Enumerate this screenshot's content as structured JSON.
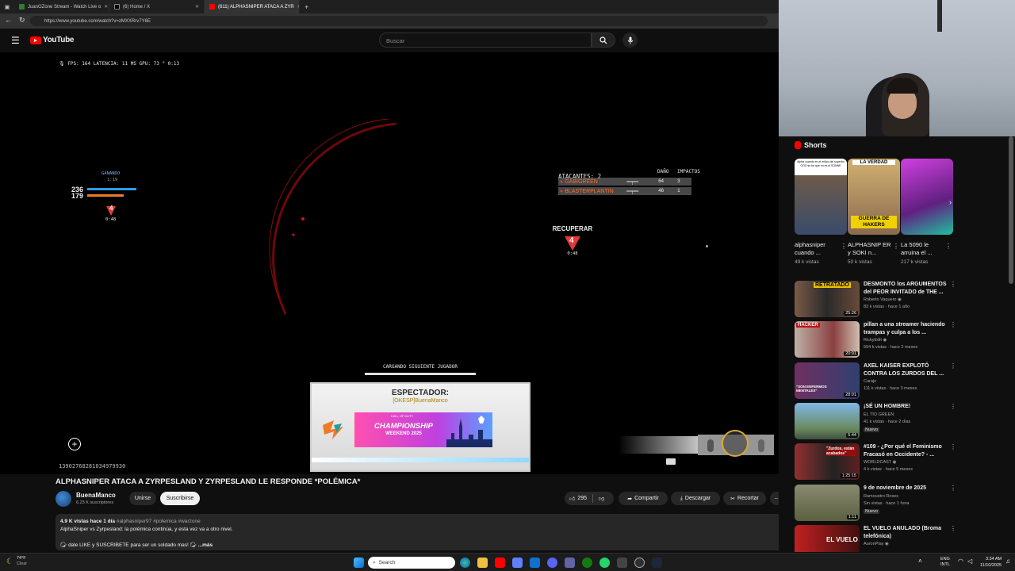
{
  "browser": {
    "tabs": [
      {
        "label": "JuanGZone Stream - Watch Live o",
        "color": "#2e7d32"
      },
      {
        "label": "(6) Home / X",
        "color": "#000000"
      },
      {
        "label": "(611) ALPHASNIPER ATACA A ZYR",
        "color": "#ff0000"
      }
    ],
    "url": "https://www.youtube.com/watch?v=zMXXRrv7Y6E"
  },
  "youtube": {
    "logo": "YouTube",
    "search_placeholder": "Buscar"
  },
  "game_hud": {
    "perf": "FPS: 164  LATENCIA: 11 MS  GPU: 73 °  0:13",
    "winning_label": "GANANDO",
    "winning_time": "1:19",
    "score_own": "236",
    "score_enemy": "179",
    "badge_number": "4",
    "badge_time": "0:48",
    "attackers_label": "ATACANTES: 2",
    "damage_label": "DAÑO",
    "impacts_label": "IMPACTOS",
    "attackers": [
      {
        "name": "GABIGREEN",
        "damage": "64",
        "impacts": "3"
      },
      {
        "name": "BLASTERPLANTIN",
        "damage": "46",
        "impacts": "1"
      }
    ],
    "recover_label": "RECUPERAR",
    "recover_number": "4",
    "recover_time": "0:48",
    "loading_label": "CARGANDO SIGUIENTE JUGADOR",
    "spectator_label": "ESPECTADOR:",
    "spectator_name": "[OKESP]BuenaManco",
    "banner_small": "CALL OF DUTY",
    "banner_main": "CHAMPIONSHIP",
    "banner_sub": "WEEKEND 2025",
    "player_id": "13902768281034979930"
  },
  "video": {
    "title": "ALPHASNIPER ATACA A ZYRPESLAND Y ZYRPESLAND LE RESPONDE *POLÉMICA*",
    "channel": "BuenaManco",
    "subscribers": "6.23 K suscriptores",
    "join_label": "Unirse",
    "subscribe_label": "Suscribirse",
    "likes": "295",
    "share_label": "Compartir",
    "download_label": "Descargar",
    "clip_label": "Recortar",
    "desc_stats": "4.9 K vistas  hace 1 día",
    "desc_tags": "#alphasniper97 #polemica #warzone",
    "desc_line1": "AlphaSniper vs Zyrpesland: la polémica continúa, y esta vez va a otro nivel.",
    "desc_line2": "dale LIKE y SUSCRIBETE para ser un soldado mas!",
    "desc_more": "...más"
  },
  "shorts": {
    "header": "Shorts",
    "items": [
      {
        "title": "alphasniper cuando ...",
        "views": "49 k vistas",
        "thumb_text": "Alpha cuando en el mítico del superior GOD se ha que no es el SONNE",
        "colors": [
          "#6d5a4a",
          "#3a4b6a"
        ]
      },
      {
        "title": "ALPHASNIP ER y SOKI n...",
        "views": "50 k vistas",
        "thumb_text": "LA VERDAD",
        "thumb_text2": "GUERRA DE HAKERS",
        "colors": [
          "#f0d000",
          "#c8a060"
        ]
      },
      {
        "title": "La 5090 le arruina el ...",
        "views": "217 k vistas",
        "thumb_text": "",
        "colors": [
          "#a020c0",
          "#30e0c0"
        ]
      }
    ]
  },
  "recommended": [
    {
      "title": "DESMONTO los ARGUMENTOS del PEOR INVITADO de THE ...",
      "channel": "Roberto Vaquero",
      "stats": "83 k vistas · hace 1 año",
      "duration": "25:26",
      "thumb_text": "RETRATADO",
      "colors": [
        "#e8c000",
        "#2a2a2a"
      ],
      "verified": true
    },
    {
      "title": "pillan a una streamer haciendo trampas y culpa a los ...",
      "channel": "RickyEdit",
      "stats": "594 k vistas · hace 2 meses",
      "duration": "20:01",
      "thumb_text": "HACKER",
      "colors": [
        "#c0c0c0",
        "#7a3030"
      ],
      "verified": true
    },
    {
      "title": "AXEL KAISER EXPLOTÓ CONTRA LOS ZURDOS DEL ...",
      "channel": "Carajo",
      "stats": "111 k vistas · hace 3 meses",
      "duration": "28:01",
      "thumb_text": "\"SON ENFERMOS MENTALES\"",
      "colors": [
        "#702060",
        "#203060"
      ],
      "verified": false
    },
    {
      "title": "¡SÉ UN HOMBRE!",
      "channel": "EL TÍO GREEN",
      "stats": "41 k vistas · hace 2 días",
      "duration": "5:44",
      "badge": "Nuevo",
      "thumb_text": "",
      "colors": [
        "#6aa0d0",
        "#405060"
      ],
      "verified": false
    },
    {
      "title": "#109 - ¿Por qué el Feminismo Fracasó en Occidente? - ...",
      "channel": "WORLDCAST",
      "stats": "4 k vistas · hace 5 meses",
      "duration": "1:25:15",
      "thumb_text": "\"Zurdos, están acabados\"",
      "colors": [
        "#802020",
        "#303030"
      ],
      "verified": true
    },
    {
      "title": "9 de noviembre de 2025",
      "channel": "Ramoustro Reses",
      "stats": "Sin vistas · hace 1 hora",
      "duration": "1:11",
      "badge": "Nuevo",
      "thumb_text": "",
      "colors": [
        "#5a6040",
        "#8a8a60"
      ],
      "verified": false
    },
    {
      "title": "EL VUELO ANULADO (Broma telefónica)",
      "channel": "AuronPlay",
      "stats": "",
      "duration": "",
      "thumb_text": "EL VUELO",
      "colors": [
        "#c02020",
        "#401010"
      ],
      "verified": true
    }
  ],
  "taskbar": {
    "weather_temp": "74°F",
    "weather_desc": "Clear",
    "search_placeholder": "Search",
    "lang": "ENG",
    "region": "INTL",
    "time": "3:34 AM",
    "date": "11/10/2025"
  },
  "colors": {
    "accent_red": "#ff0000",
    "hud_blue": "#2f9be8",
    "hud_orange": "#f07a2a"
  }
}
